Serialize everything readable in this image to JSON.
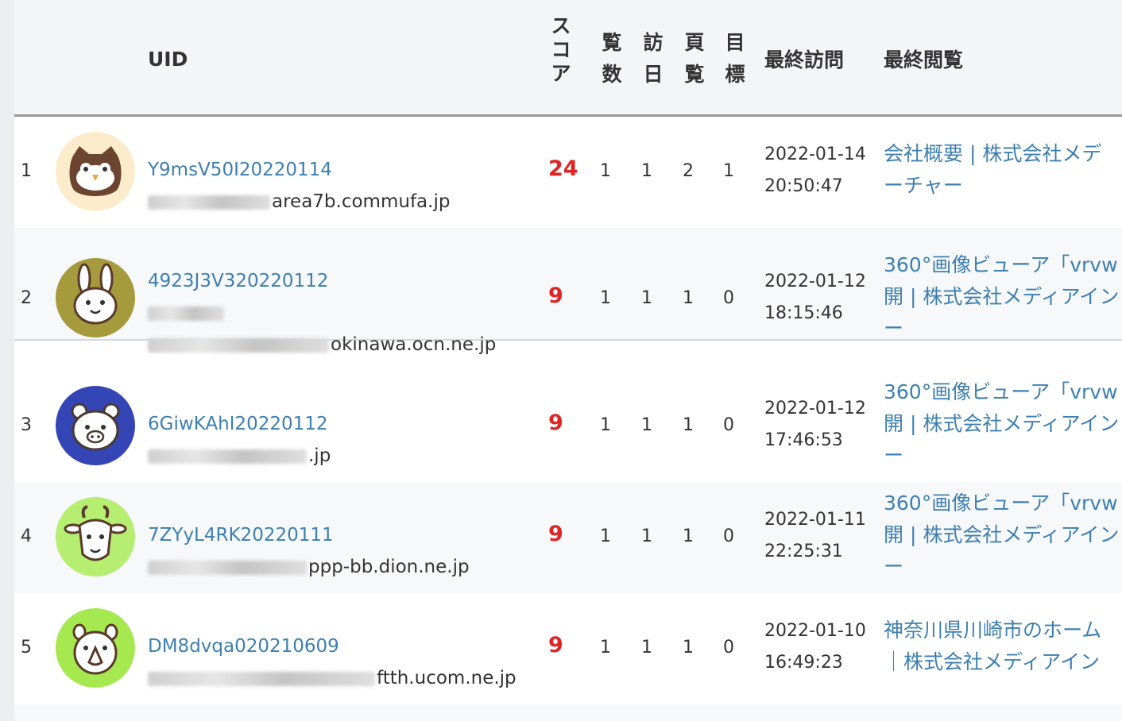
{
  "header": {
    "uid_label": "UID",
    "score_label": [
      "ス",
      "コ",
      "ア"
    ],
    "views_label": [
      "覧",
      "数"
    ],
    "visit_days_label": [
      "訪",
      "日"
    ],
    "pages_label": [
      "頁",
      "覧"
    ],
    "goals_label": [
      "目",
      "標"
    ],
    "last_visit_label": "最終訪問",
    "last_view_label": "最終閲覧"
  },
  "colors": {
    "link": "#3d7fb0",
    "score": "#e02424",
    "header_bg": "#f4f5f7"
  },
  "rows": [
    {
      "num": "1",
      "avatar": "owl-icon",
      "uid": "Y9msV50I20220114",
      "host_lines": [
        "area7b.commufa.jp"
      ],
      "score": "24",
      "views": "1",
      "days": "1",
      "pages": "2",
      "goals": "1",
      "date": "2022-01-14",
      "time": "20:50:47",
      "page_lines": [
        "会社概要 | 株式会社メデ",
        "ーチャー"
      ]
    },
    {
      "num": "2",
      "avatar": "rabbit-icon",
      "uid": "4923J3V320220112",
      "host_lines": [
        "",
        "okinawa.ocn.ne.jp"
      ],
      "score": "9",
      "views": "1",
      "days": "1",
      "pages": "1",
      "goals": "0",
      "date": "2022-01-12",
      "time": "18:15:46",
      "page_lines": [
        "360°画像ビューア「vrvw",
        "開 | 株式会社メディアイン",
        "ー"
      ]
    },
    {
      "num": "3",
      "avatar": "wombat-icon",
      "uid": "6GiwKAhI20220112",
      "host_lines": [
        ".jp"
      ],
      "score": "9",
      "views": "1",
      "days": "1",
      "pages": "1",
      "goals": "0",
      "date": "2022-01-12",
      "time": "17:46:53",
      "page_lines": [
        "360°画像ビューア「vrvw",
        "開 | 株式会社メディアイン",
        "ー"
      ]
    },
    {
      "num": "4",
      "avatar": "goat-icon",
      "uid": "7ZYyL4RK20220111",
      "host_lines": [
        "ppp-bb.dion.ne.jp"
      ],
      "score": "9",
      "views": "1",
      "days": "1",
      "pages": "1",
      "goals": "0",
      "date": "2022-01-11",
      "time": "22:25:31",
      "page_lines": [
        "360°画像ビューア「vrvw",
        "開 | 株式会社メディアイン",
        "ー"
      ]
    },
    {
      "num": "5",
      "avatar": "rhino-icon",
      "uid": "DM8dvqa020210609",
      "host_lines": [
        "ftth.ucom.ne.jp"
      ],
      "score": "9",
      "views": "1",
      "days": "1",
      "pages": "1",
      "goals": "0",
      "date": "2022-01-10",
      "time": "16:49:23",
      "page_lines": [
        "神奈川県川崎市のホーム",
        "｜株式会社メディアイン"
      ]
    }
  ]
}
